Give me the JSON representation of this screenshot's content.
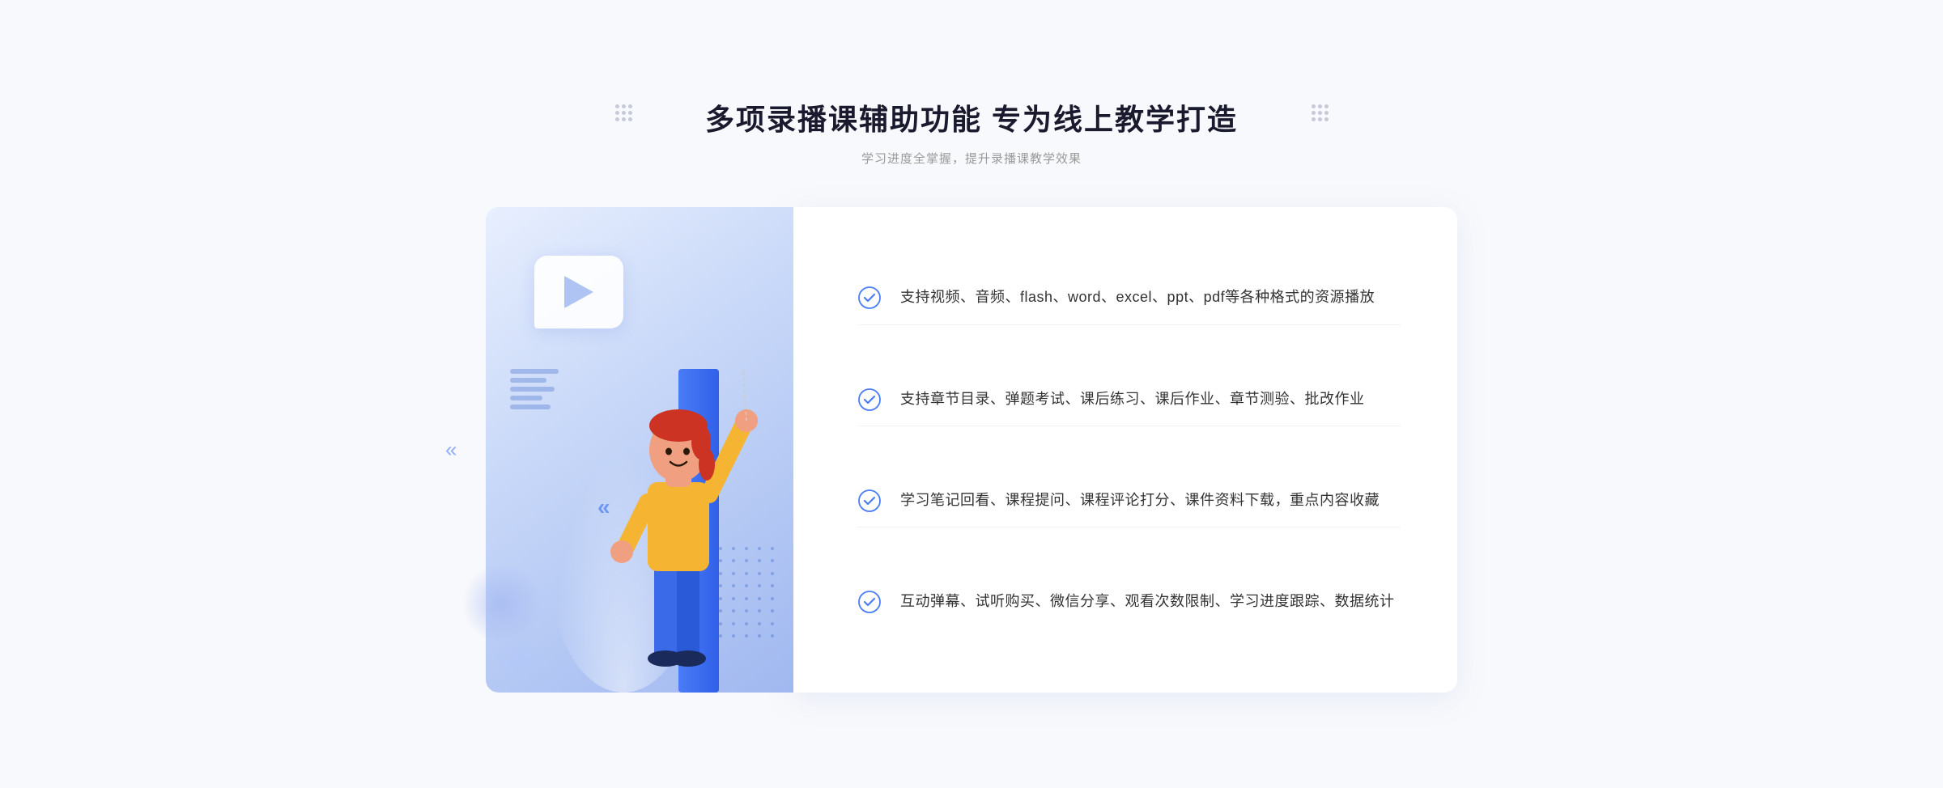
{
  "header": {
    "title": "多项录播课辅助功能 专为线上教学打造",
    "subtitle": "学习进度全掌握，提升录播课教学效果"
  },
  "features": [
    {
      "id": "feature-1",
      "text": "支持视频、音频、flash、word、excel、ppt、pdf等各种格式的资源播放"
    },
    {
      "id": "feature-2",
      "text": "支持章节目录、弹题考试、课后练习、课后作业、章节测验、批改作业"
    },
    {
      "id": "feature-3",
      "text": "学习笔记回看、课程提问、课程评论打分、课件资料下载，重点内容收藏"
    },
    {
      "id": "feature-4",
      "text": "互动弹幕、试听购买、微信分享、观看次数限制、学习进度跟踪、数据统计"
    }
  ],
  "decorations": {
    "left_arrows": "«",
    "check_symbol": "✓"
  }
}
